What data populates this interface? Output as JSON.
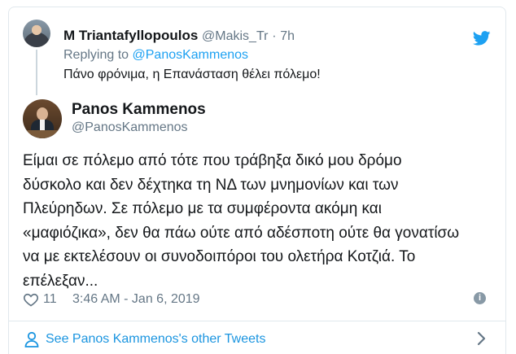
{
  "parent_tweet": {
    "name": "M Triantafyllopoulos",
    "handle": "@Makis_Tr",
    "separator": "·",
    "time": "7h",
    "replying_prefix": "Replying to ",
    "replying_to": "@PanosKammenos",
    "text": "Πάνο φρόνιμα, η Επανάσταση θέλει πόλεμο!"
  },
  "main_tweet": {
    "name": "Panos Kammenos",
    "handle": "@PanosKammenos",
    "lines": [
      "Είμαι σε πόλεμο από τότε που τράβηξα δικό μου δρόμο",
      "δύσκολο και δεν δέχτηκα τη ΝΔ των μνημονίων και των",
      "Πλεύρηδων. Σε πόλεμο με τα συμφέροντα ακόμη και",
      "«μαφιόζικα», δεν θα πάω ούτε από αδέσποτη ούτε θα γονατίσω",
      "να με εκτελέσουν οι συνοδοιπόροι του ολετήρα Κοτζιά. Το",
      "επέλεξαν..."
    ],
    "likes": "11",
    "timestamp": "3:46 AM - Jan 6, 2019"
  },
  "footer": {
    "see_more": "See Panos Kammenos's other Tweets"
  },
  "icons": {
    "brand": "twitter-bird-icon",
    "like": "heart-icon",
    "info": "info-icon",
    "profile": "person-icon",
    "chevron": "chevron-right-icon"
  },
  "colors": {
    "brand_blue": "#1da1f2",
    "link_blue": "#1b95e0",
    "muted": "#657786",
    "text": "#14171a",
    "border": "#e1e8ed"
  }
}
